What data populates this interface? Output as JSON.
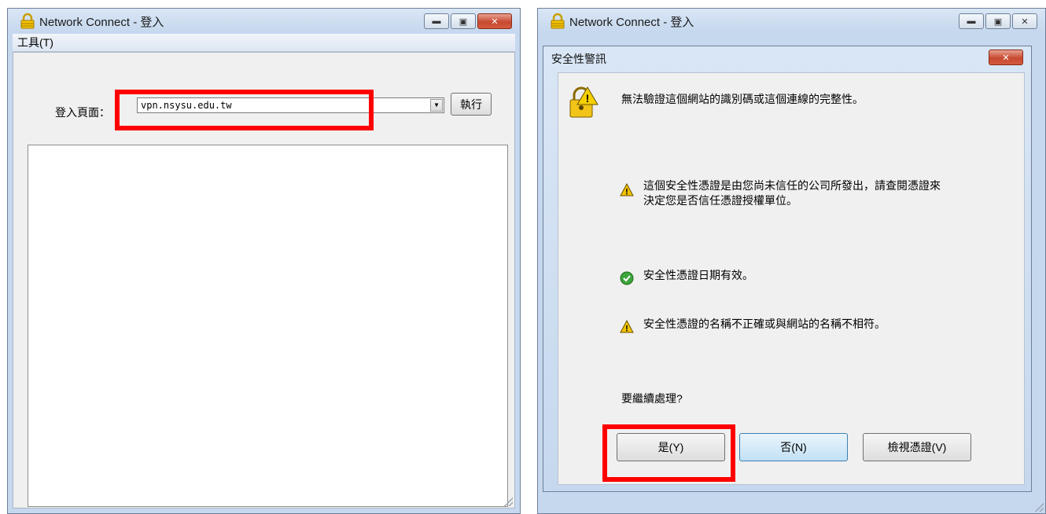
{
  "left_window": {
    "title": "Network Connect - 登入",
    "menu": "工具(T)",
    "login_label": "登入頁面：",
    "url_value": "vpn.nsysu.edu.tw",
    "run_button": "執行"
  },
  "right_window": {
    "title": "Network Connect - 登入"
  },
  "dialog": {
    "title": "安全性警訊",
    "main_message": "無法驗證這個網站的識別碼或這個連線的完整性。",
    "items": [
      {
        "icon": "warning-icon",
        "line1": "這個安全性憑證是由您尚未信任的公司所發出，請查閱憑證來",
        "line2": "決定您是否信任憑證授權單位。"
      },
      {
        "icon": "check-icon",
        "line1": "安全性憑證日期有效。"
      },
      {
        "icon": "warning-icon",
        "line1": "安全性憑證的名稱不正確或與網站的名稱不相符。"
      }
    ],
    "question": "要繼續處理?",
    "buttons": {
      "yes": "是(Y)",
      "no": "否(N)",
      "view": "檢視憑證(V)"
    }
  },
  "colors": {
    "highlight": "#ff0000",
    "warning": "#f2c200",
    "check": "#3ca53c"
  }
}
